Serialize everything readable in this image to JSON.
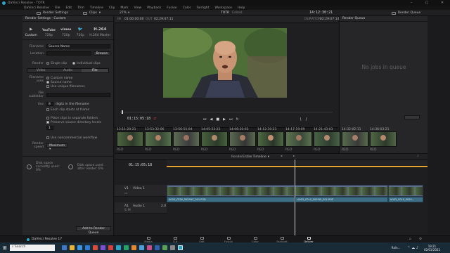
{
  "titlebar": {
    "title": "DaVinci Resolve - TOTR"
  },
  "menu": [
    "DaVinci Resolve",
    "File",
    "Edit",
    "Trim",
    "Timeline",
    "Clip",
    "Mark",
    "View",
    "Playback",
    "Fusion",
    "Color",
    "Fairlight",
    "Workspace",
    "Help"
  ],
  "topbar": {
    "render_settings": "Render Settings",
    "clips": "Clips",
    "zoom": "27%",
    "project": "TOTR",
    "status": "Edited",
    "timecode": "14:12:30:21",
    "render_queue": "Render Queue"
  },
  "render_settings": {
    "header": "Render Settings - Custom",
    "presets": [
      {
        "logo": "▶",
        "label": "Custom"
      },
      {
        "logo": "YouTube",
        "label": "720p"
      },
      {
        "logo": "vimeo",
        "label": "720p"
      },
      {
        "logo": "🐦",
        "label": "720p"
      },
      {
        "logo": "H.264",
        "label": "H.264 Master"
      }
    ],
    "filename_label": "Filename",
    "filename_value": "Source Name",
    "location_label": "Location",
    "browse": "Browse",
    "render_label": "Render",
    "single_clip": "Single clip",
    "individual_clips": "Individual clips",
    "tabs": [
      "Video",
      "Audio",
      "File"
    ],
    "filename_uses_label": "Filename uses",
    "opt_custom": "Custom name",
    "opt_source": "Source name",
    "opt_unique": "Use unique filenames",
    "subfolder_label": "File subfolder",
    "use_label": "Use",
    "digits_value": "8",
    "digits_text": "digits in the filename",
    "each_clip": "Each clip starts at frame",
    "place_clips": "Place clips in separate folders",
    "preserve": "Preserve source directory levels",
    "preserve_value": "1",
    "use_noncommercial": "Use noncommercial workflow",
    "render_speed_label": "Render speed",
    "render_speed_value": "Maximum",
    "disk_a": "Disk space currently used: 0%",
    "disk_b": "Disk space used after render: 0%",
    "add_to_queue": "Add to Render Queue"
  },
  "viewer": {
    "start_label": "IN",
    "in_tc": "01:00:00:00",
    "dur_label": "OUT",
    "out_tc": "02:29:07:11",
    "duration_label": "DURATION",
    "duration": "02:29:07:14",
    "current_tc": "01:15:05:18",
    "timeline_name": "TOTR"
  },
  "render_queue": {
    "header": "Render Queue",
    "empty": "No jobs in queue"
  },
  "strip": {
    "timecodes": [
      "13:11:20:21",
      "13:53:32:06",
      "13:56:55:04",
      "14:05:53:22",
      "14:06:20:03",
      "14:12:30:21",
      "14:17:19:09",
      "14:21:43:03",
      "14:32:02:11",
      "14:36:03:21"
    ],
    "badges": [
      "RED",
      "RED",
      "RED",
      "RED",
      "RED",
      "RED",
      "RED",
      "RED",
      "RED",
      "RED"
    ]
  },
  "timeline": {
    "render_label": "Render",
    "render_value": "Entire Timeline",
    "timecode": "01:15:05:18",
    "video_track": "V1",
    "video_track_name": "Video 1",
    "audio_track": "A1",
    "audio_track_name": "Audio 1",
    "audio_value": "2.0",
    "audio_clips": [
      "A003_C016_0929HC_001.R3D",
      "A003_C016_0929HB_001.R3D",
      "A003_C015_0929IG_001.R3D",
      "A003_C010_0929..."
    ]
  },
  "pages": [
    {
      "label": "Media",
      "active": false
    },
    {
      "label": "Cut",
      "active": false
    },
    {
      "label": "Edit",
      "active": false
    },
    {
      "label": "Fusion",
      "active": false
    },
    {
      "label": "Color",
      "active": false
    },
    {
      "label": "Fairlight",
      "active": false
    },
    {
      "label": "Deliver",
      "active": true
    }
  ],
  "app_footer": "DaVinci Resolve 17",
  "taskbar": {
    "search": "Search",
    "time": "19:21",
    "date": "02/01/2022",
    "weather": "Rain..."
  },
  "colors": {
    "accent": "#e6a431",
    "video_clip": "#5a6d8c",
    "audio_clip": "#3d6e86",
    "red_tc": "#d23b3b"
  }
}
